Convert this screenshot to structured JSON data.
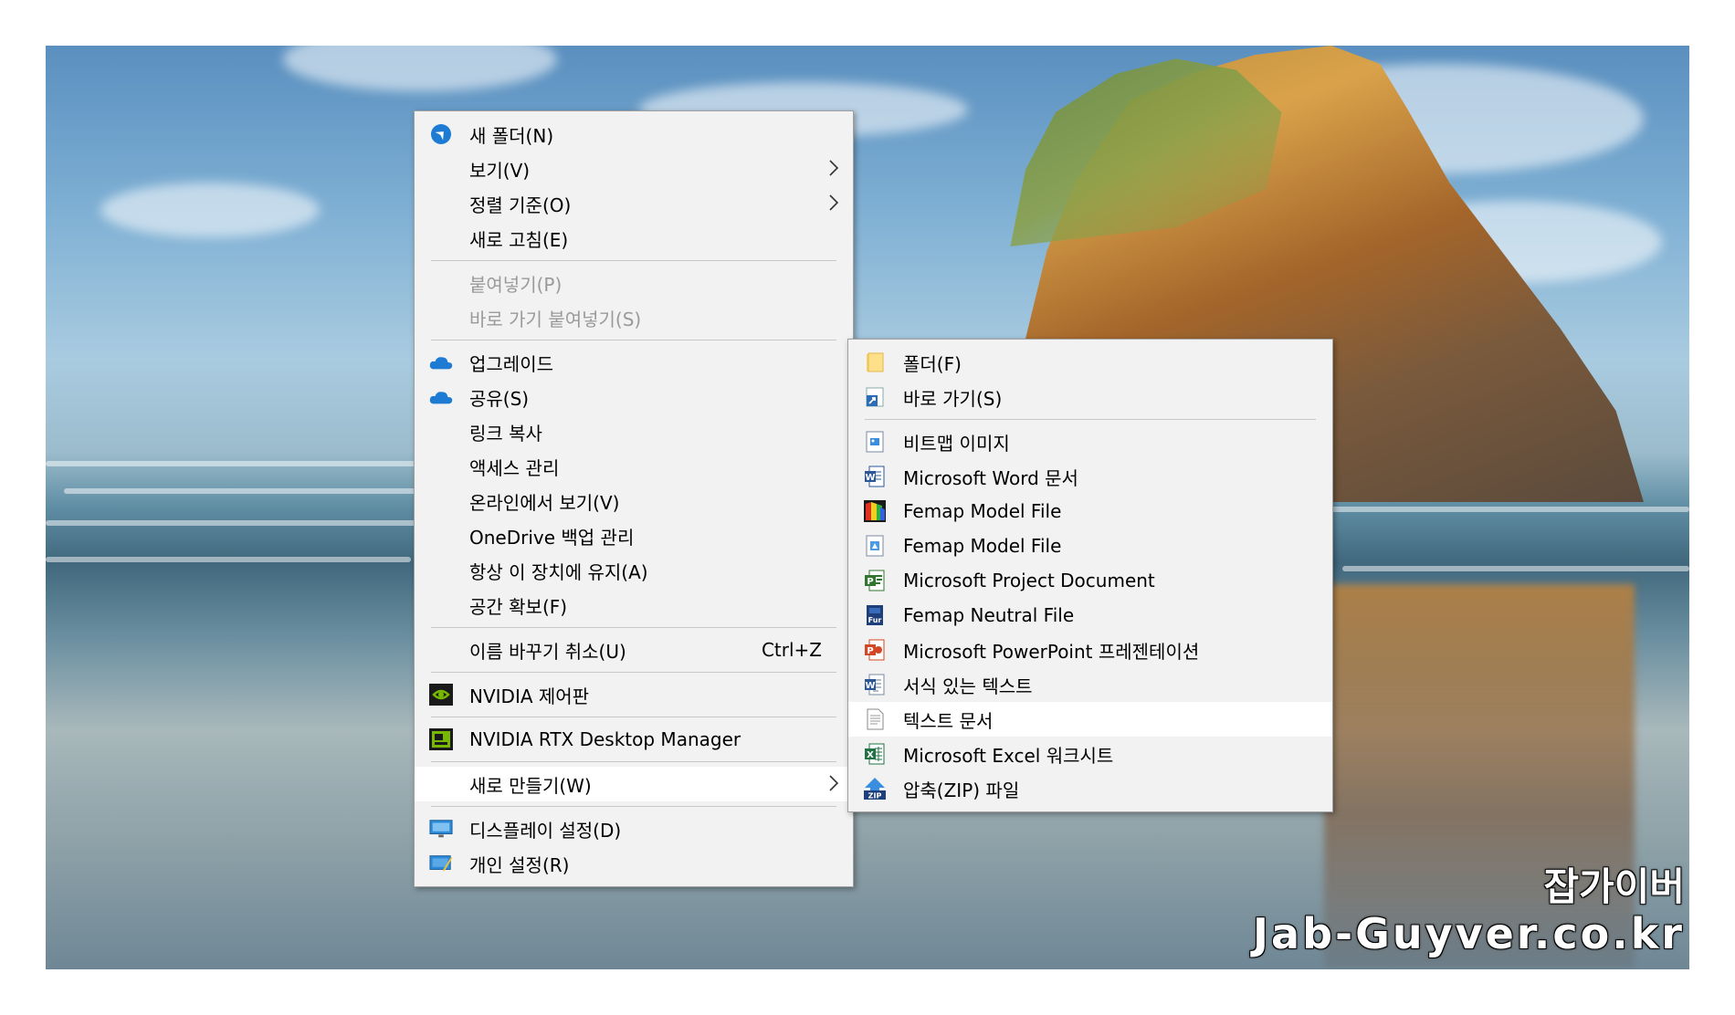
{
  "main_menu": {
    "items": [
      {
        "label": "새 폴더(N)",
        "icon": "blue-arrow-icon"
      },
      {
        "label": "보기(V)",
        "submenu": true
      },
      {
        "label": "정렬 기준(O)",
        "submenu": true
      },
      {
        "label": "새로 고침(E)"
      },
      {
        "label": "붙여넣기(P)",
        "disabled": true
      },
      {
        "label": "바로 가기 붙여넣기(S)",
        "disabled": true
      },
      {
        "label": "업그레이드",
        "icon": "onedrive-cloud-icon"
      },
      {
        "label": "공유(S)",
        "icon": "onedrive-cloud-icon"
      },
      {
        "label": "링크 복사"
      },
      {
        "label": "액세스 관리"
      },
      {
        "label": "온라인에서 보기(V)"
      },
      {
        "label": "OneDrive 백업 관리"
      },
      {
        "label": "항상 이 장치에 유지(A)"
      },
      {
        "label": "공간 확보(F)"
      },
      {
        "label": "이름 바꾸기 취소(U)",
        "shortcut": "Ctrl+Z"
      },
      {
        "label": "NVIDIA 제어판",
        "icon": "nvidia-icon"
      },
      {
        "label": "NVIDIA RTX Desktop Manager",
        "icon": "nvidia-rtx-icon"
      },
      {
        "label": "새로 만들기(W)",
        "submenu": true,
        "highlight": true
      },
      {
        "label": "디스플레이 설정(D)",
        "icon": "display-icon"
      },
      {
        "label": "개인 설정(R)",
        "icon": "personalize-icon"
      }
    ]
  },
  "new_submenu": {
    "items": [
      {
        "label": "폴더(F)",
        "icon": "folder-icon"
      },
      {
        "label": "바로 가기(S)",
        "icon": "shortcut-icon"
      },
      {
        "label": "비트맵 이미지",
        "icon": "bitmap-icon"
      },
      {
        "label": "Microsoft Word 문서",
        "icon": "word-icon"
      },
      {
        "label": "Femap Model File",
        "icon": "femap-color-icon"
      },
      {
        "label": "Femap Model File",
        "icon": "femap-model-icon"
      },
      {
        "label": "Microsoft Project Document",
        "icon": "project-icon"
      },
      {
        "label": "Femap Neutral File",
        "icon": "femap-neutral-icon"
      },
      {
        "label": "Microsoft PowerPoint 프레젠테이션",
        "icon": "powerpoint-icon"
      },
      {
        "label": "서식 있는 텍스트",
        "icon": "rtf-icon"
      },
      {
        "label": "텍스트 문서",
        "icon": "text-doc-icon",
        "highlight": true
      },
      {
        "label": "Microsoft Excel 워크시트",
        "icon": "excel-icon"
      },
      {
        "label": "압축(ZIP) 파일",
        "icon": "zip-icon"
      }
    ]
  },
  "watermark": {
    "line1": "잡가이버",
    "line2": "Jab-Guyver.co.kr"
  },
  "colors": {
    "menu_bg": "#f2f2f2",
    "highlight_bg": "#ffffff",
    "disabled_text": "#9a9a9a",
    "onedrive_blue": "#1e7bd4",
    "nvidia_green": "#76b900",
    "word_blue": "#2b5797",
    "excel_green": "#217346",
    "ppt_red": "#d24726",
    "project_green": "#31752f"
  },
  "badge_letters": {
    "word": "W",
    "excel": "X",
    "ppt": "P",
    "project": "P",
    "rtf": "W",
    "femap_neutral": "Fur",
    "zip": "ZIP"
  }
}
